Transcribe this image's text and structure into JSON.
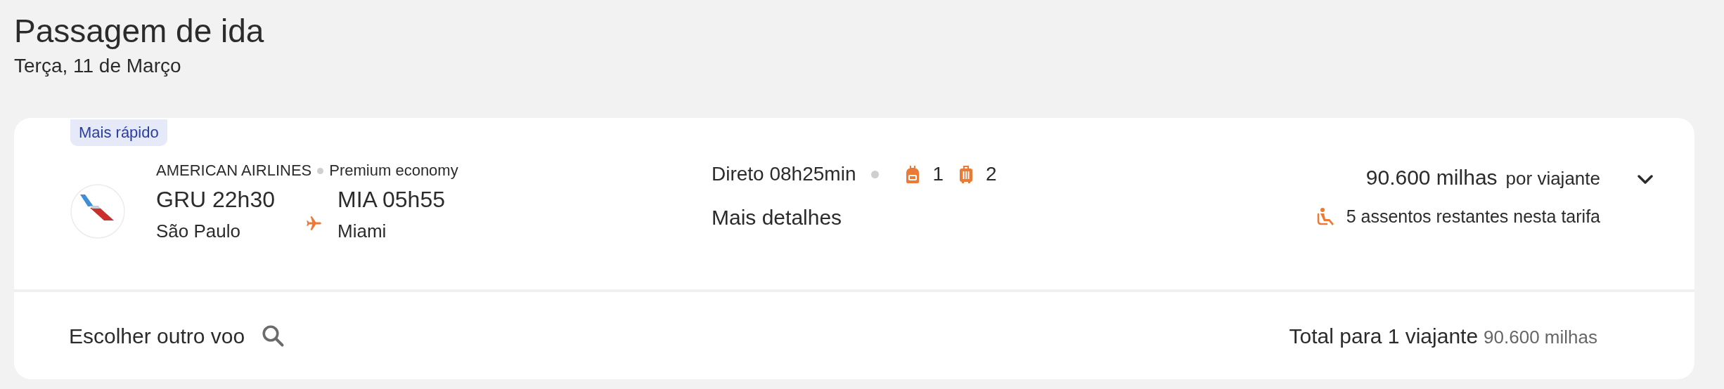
{
  "title": "Passagem de ida",
  "subtitle": "Terça, 11 de Março",
  "flight": {
    "badge": "Mais rápido",
    "airline": "AMERICAN AIRLINES",
    "cabin": "Premium economy",
    "departure": {
      "code_time": "GRU 22h30",
      "city": "São Paulo"
    },
    "arrival": {
      "code_time": "MIA 05h55",
      "city": "Miami"
    },
    "duration": "Direto 08h25min",
    "details_link": "Mais detalhes",
    "baggage": [
      {
        "kind": "backpack",
        "count": "1"
      },
      {
        "kind": "suitcase",
        "count": "2"
      }
    ],
    "price": "90.600 milhas",
    "price_unit": "por viajante",
    "seats": "5 assentos restantes nesta tarifa",
    "expanded": false
  },
  "footer": {
    "choose_other": "Escolher outro voo",
    "total_label": "Total para 1 viajante",
    "total_value": "90.600 milhas"
  }
}
